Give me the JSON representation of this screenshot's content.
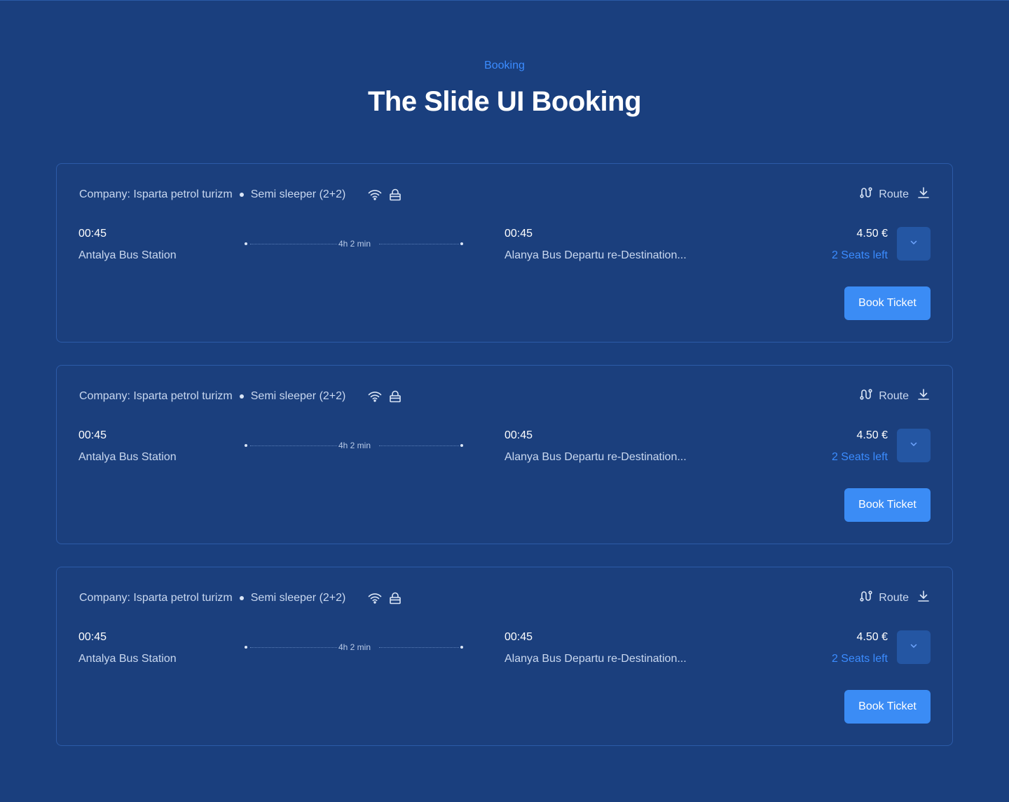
{
  "header": {
    "eyebrow": "Booking",
    "title": "The Slide UI Booking"
  },
  "colors": {
    "background": "#1a3f7e",
    "accent": "#3b8cff",
    "button": "#3b8cf5"
  },
  "icons": [
    "wifi-icon",
    "lock-icon",
    "route-icon",
    "download-icon",
    "chevron-down-icon"
  ],
  "tickets": [
    {
      "company": "Company: Isparta petrol turizm",
      "bus_type": "Semi sleeper (2+2)",
      "route_label": "Route",
      "departure_time": "00:45",
      "departure_station": "Antalya Bus Station",
      "duration": "4h 2 min",
      "arrival_time": "00:45",
      "arrival_station": "Alanya Bus Departu re-Destination...",
      "price": "4.50 €",
      "seats": "2 Seats left",
      "book_label": "Book Ticket"
    },
    {
      "company": "Company: Isparta petrol turizm",
      "bus_type": "Semi sleeper (2+2)",
      "route_label": "Route",
      "departure_time": "00:45",
      "departure_station": "Antalya Bus Station",
      "duration": "4h 2 min",
      "arrival_time": "00:45",
      "arrival_station": "Alanya Bus Departu re-Destination...",
      "price": "4.50 €",
      "seats": "2 Seats left",
      "book_label": "Book Ticket"
    },
    {
      "company": "Company: Isparta petrol turizm",
      "bus_type": "Semi sleeper (2+2)",
      "route_label": "Route",
      "departure_time": "00:45",
      "departure_station": "Antalya Bus Station",
      "duration": "4h 2 min",
      "arrival_time": "00:45",
      "arrival_station": "Alanya Bus Departu re-Destination...",
      "price": "4.50 €",
      "seats": "2 Seats left",
      "book_label": "Book Ticket"
    }
  ]
}
